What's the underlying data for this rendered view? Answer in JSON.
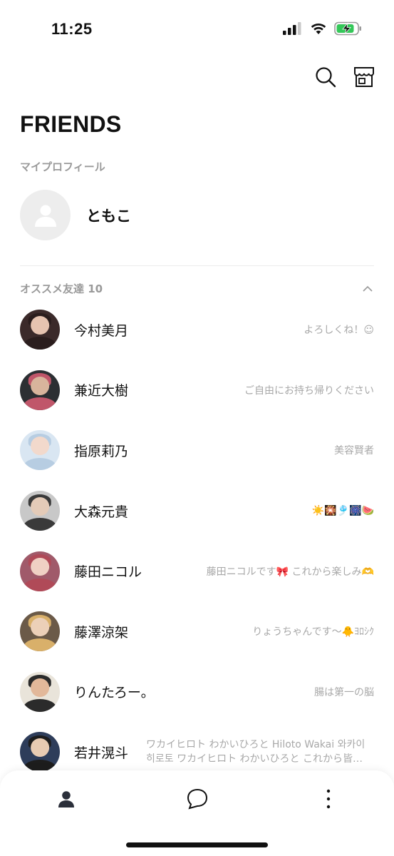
{
  "status_bar": {
    "time": "11:25"
  },
  "header": {
    "title": "FRIENDS",
    "search_icon": "search-icon",
    "shop_icon": "shop-icon"
  },
  "my_profile": {
    "section_label": "マイプロフィール",
    "name": "ともこ"
  },
  "recommended": {
    "section_label": "オススメ友達 10",
    "friends": [
      {
        "name": "今村美月",
        "status": "よろしくね！☺︎",
        "avatar_colors": [
          "#3b2a2a",
          "#e6c3b0",
          "#2a1d1d"
        ]
      },
      {
        "name": "兼近大樹",
        "status": "ご自由にお持ち帰りください",
        "avatar_colors": [
          "#2c2f33",
          "#d8b49c",
          "#c0566a"
        ]
      },
      {
        "name": "指原莉乃",
        "status": "美容賢者",
        "avatar_colors": [
          "#d9e6f2",
          "#f2d9cc",
          "#b7cde2"
        ]
      },
      {
        "name": "大森元貴",
        "status": "☀️🎇🎐🎆🍉",
        "avatar_colors": [
          "#c8c8c8",
          "#e4cbb8",
          "#3a3a3a"
        ]
      },
      {
        "name": "藤田ニコル",
        "status": "藤田ニコルです🎀 これから楽しみ🫶",
        "avatar_colors": [
          "#a05a6a",
          "#f0d0c4",
          "#b04a58"
        ]
      },
      {
        "name": "藤澤涼架",
        "status": "りょうちゃんです〜🐥ﾖﾛｼｸ",
        "avatar_colors": [
          "#6b5a48",
          "#ecd0b8",
          "#d9b06a"
        ]
      },
      {
        "name": "りんたろー。",
        "status": "腸は第一の脳",
        "avatar_colors": [
          "#e9e4da",
          "#e2b89a",
          "#2b2b2b"
        ]
      },
      {
        "name": "若井滉斗",
        "status": "ワカイヒロト わかいひろと Hiloto Wakai 와카이 히로토 ワカイヒロト わかいひろと これから皆…",
        "avatar_colors": [
          "#2e3d5a",
          "#e8cbb2",
          "#1d1d1d"
        ]
      }
    ]
  },
  "tab_bar": {
    "home_icon": "person-icon",
    "chat_icon": "chat-bubble-icon",
    "more_icon": "more-dots-icon"
  }
}
